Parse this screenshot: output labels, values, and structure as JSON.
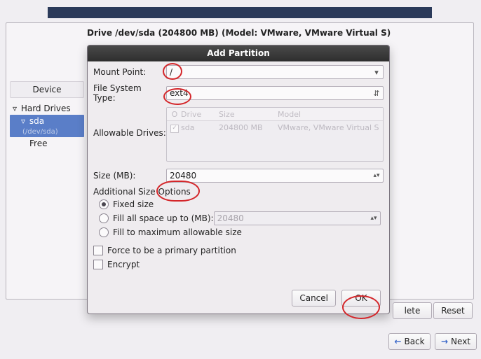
{
  "header_bar": "",
  "drive_info": "Drive /dev/sda (204800 MB) (Model: VMware, VMware Virtual S)",
  "device_column_header": "Device",
  "tree": {
    "hard_drives": "Hard Drives",
    "sda": "sda",
    "sda_suffix": "(/dev/sda)",
    "free": "Free"
  },
  "dialog": {
    "title": "Add Partition",
    "mount_point_label": "Mount Point:",
    "mount_point_value": "/",
    "fs_type_label": "File System Type:",
    "fs_type_value": "ext4",
    "allowable_label": "Allowable Drives:",
    "drive_table": {
      "cols": {
        "chk": "O",
        "drive": "Drive",
        "size": "Size",
        "model": "Model"
      },
      "row": {
        "checked": "✓",
        "drive": "sda",
        "size": "204800 MB",
        "model": "VMware, VMware Virtual S"
      }
    },
    "size_label": "Size (MB):",
    "size_value": "20480",
    "options_label": "Additional Size Options",
    "radio_fixed": "Fixed size",
    "radio_fillupto": "Fill all space up to (MB):",
    "fillupto_value": "20480",
    "radio_fillmax": "Fill to maximum allowable size",
    "chk_primary": "Force to be a primary partition",
    "chk_encrypt": "Encrypt",
    "btn_cancel": "Cancel",
    "btn_ok": "OK"
  },
  "bg_buttons": {
    "delete": "lete",
    "reset": "Reset",
    "back": "Back",
    "next": "Next"
  }
}
